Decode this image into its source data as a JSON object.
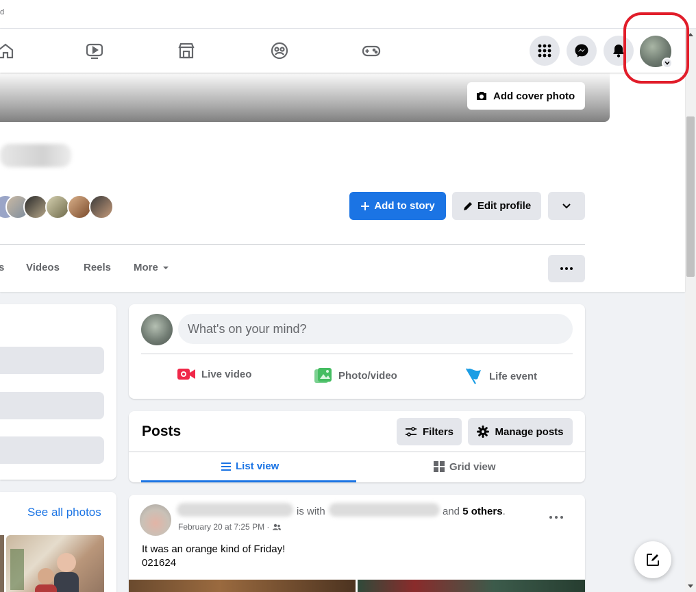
{
  "browser": {
    "title_fragment": "d"
  },
  "navbar": {
    "icons": [
      "home-icon",
      "video-icon",
      "marketplace-icon",
      "groups-icon",
      "gaming-icon"
    ],
    "right_icons": [
      "menu-grid-icon",
      "messenger-icon",
      "notifications-icon"
    ]
  },
  "profile": {
    "add_cover_label": "Add cover photo",
    "add_story_label": "Add to story",
    "edit_profile_label": "Edit profile"
  },
  "tabs": {
    "partial": "s",
    "videos": "Videos",
    "reels": "Reels",
    "more": "More"
  },
  "left": {
    "see_all_photos": "See all photos"
  },
  "composer": {
    "placeholder": "What's on your mind?",
    "live_video": "Live video",
    "photo_video": "Photo/video",
    "life_event": "Life event"
  },
  "posts": {
    "title": "Posts",
    "filters": "Filters",
    "manage": "Manage posts",
    "list_view": "List view",
    "grid_view": "Grid view"
  },
  "post": {
    "is_with": "is with",
    "and": "and",
    "others": "5 others",
    "period": ".",
    "date": "February 20 at 7:25 PM ·",
    "text_line1": "It was an orange kind of Friday!",
    "text_line2": "021624"
  },
  "colors": {
    "accent": "#1b74e4",
    "highlight": "#e11d2a",
    "live_red": "#f02849",
    "photo_green": "#45bd62",
    "flag_blue": "#1b9de4"
  }
}
